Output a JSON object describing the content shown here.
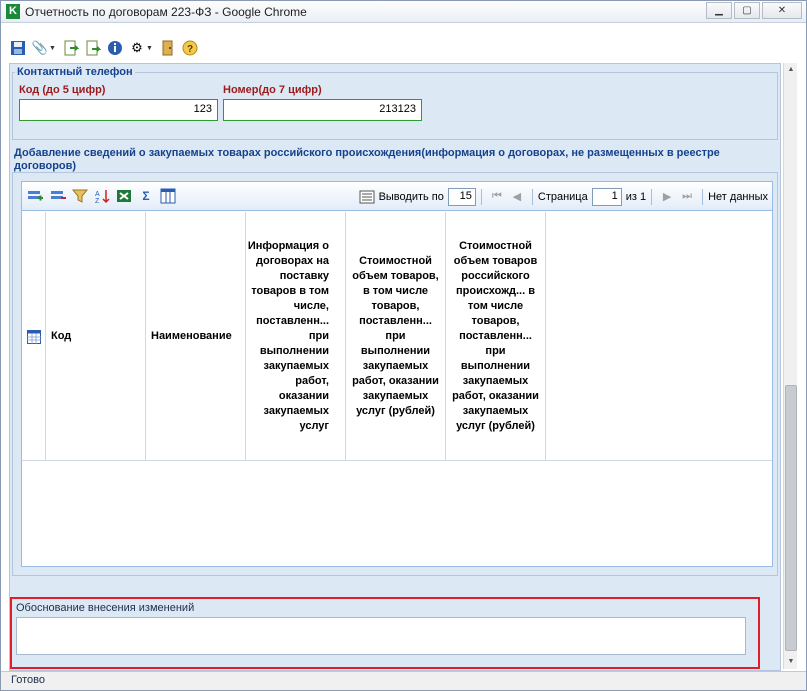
{
  "window": {
    "title": "Отчетность по договорам 223-ФЗ - Google Chrome"
  },
  "titlebar_buttons": [
    "minimize",
    "maximize",
    "close"
  ],
  "toolbar": {
    "icons": [
      "save-icon",
      "attach-icon",
      "export-icon",
      "export2-icon",
      "info-icon",
      "tools-icon",
      "exit-icon",
      "help-icon"
    ]
  },
  "contact": {
    "legend": "Контактный телефон",
    "code_label": "Код (до 5 цифр)",
    "code_value": "123",
    "number_label": "Номер(до 7 цифр)",
    "number_value": "213123"
  },
  "section": {
    "title": "Добавление сведений о закупаемых товарах российского происхождения(информация о договорах, не размещенных в реестре договоров)"
  },
  "grid": {
    "toolbar_icons": [
      "add-row-icon",
      "delete-row-icon",
      "filter-icon",
      "sort-icon",
      "excel-icon",
      "sum-icon",
      "columns-icon"
    ],
    "pager": {
      "page_size_label": "Выводить по",
      "page_size": "15",
      "page_label": "Страница",
      "page": "1",
      "of_label": "из 1",
      "no_data": "Нет данных"
    },
    "columns": [
      {
        "label": "Код"
      },
      {
        "label": "Наименование"
      },
      {
        "label": "Информация о договорах на поставку товаров в том числе, поставленн... при выполнении закупаемых работ, оказании закупаемых услуг"
      },
      {
        "label": "Стоимостной объем товаров, в том числе товаров, поставленн... при выполнении закупаемых работ, оказании закупаемых услуг (рублей)"
      },
      {
        "label": "Стоимостной объем товаров российского происхожд... в том числе товаров, поставленн... при выполнении закупаемых работ, оказании закупаемых услуг (рублей)"
      }
    ]
  },
  "justification": {
    "label": "Обоснование внесения изменений",
    "value": ""
  },
  "status": {
    "text": "Готово"
  }
}
